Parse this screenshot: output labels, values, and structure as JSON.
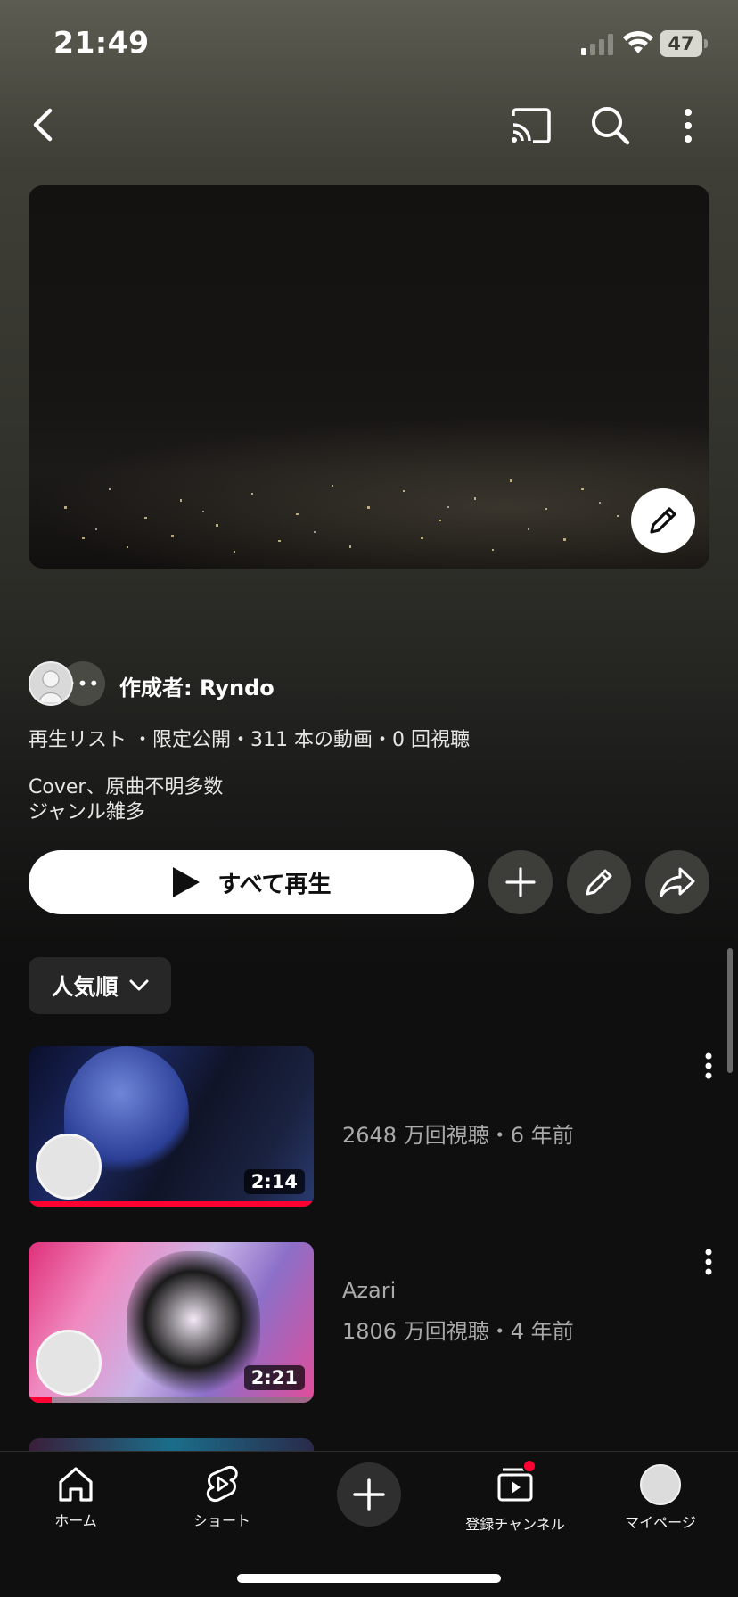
{
  "status_bar": {
    "time": "21:49",
    "battery": "47"
  },
  "playlist": {
    "creator_label": "作成者: Ryndo",
    "meta": "再生リスト ・限定公開・311 本の動画・0 回視聴",
    "description_line1": "Cover、原曲不明多数",
    "description_line2": "ジャンル雑多",
    "play_all_label": "すべて再生"
  },
  "sort": {
    "label": "人気順"
  },
  "videos": [
    {
      "title": "",
      "meta": "2648 万回視聴・6 年前",
      "duration": "2:14",
      "progress": 1.0
    },
    {
      "title": "Azari",
      "meta": "1806 万回視聴・4 年前",
      "duration": "2:21",
      "progress": 0.08
    }
  ],
  "bottom_nav": {
    "home": "ホーム",
    "shorts": "ショート",
    "subscriptions": "登録チャンネル",
    "mypage": "マイページ"
  },
  "colors": {
    "accent": "#ff0033",
    "background": "#0f0f0f"
  },
  "icons": {
    "back": "back-arrow-icon",
    "cast": "cast-icon",
    "search": "search-icon",
    "more": "more-vertical-icon",
    "edit": "pencil-icon",
    "add": "plus-icon",
    "share": "share-icon",
    "play": "play-icon",
    "home": "home-icon",
    "shorts": "shorts-icon",
    "create": "plus-icon",
    "subscriptions": "subscriptions-icon"
  }
}
